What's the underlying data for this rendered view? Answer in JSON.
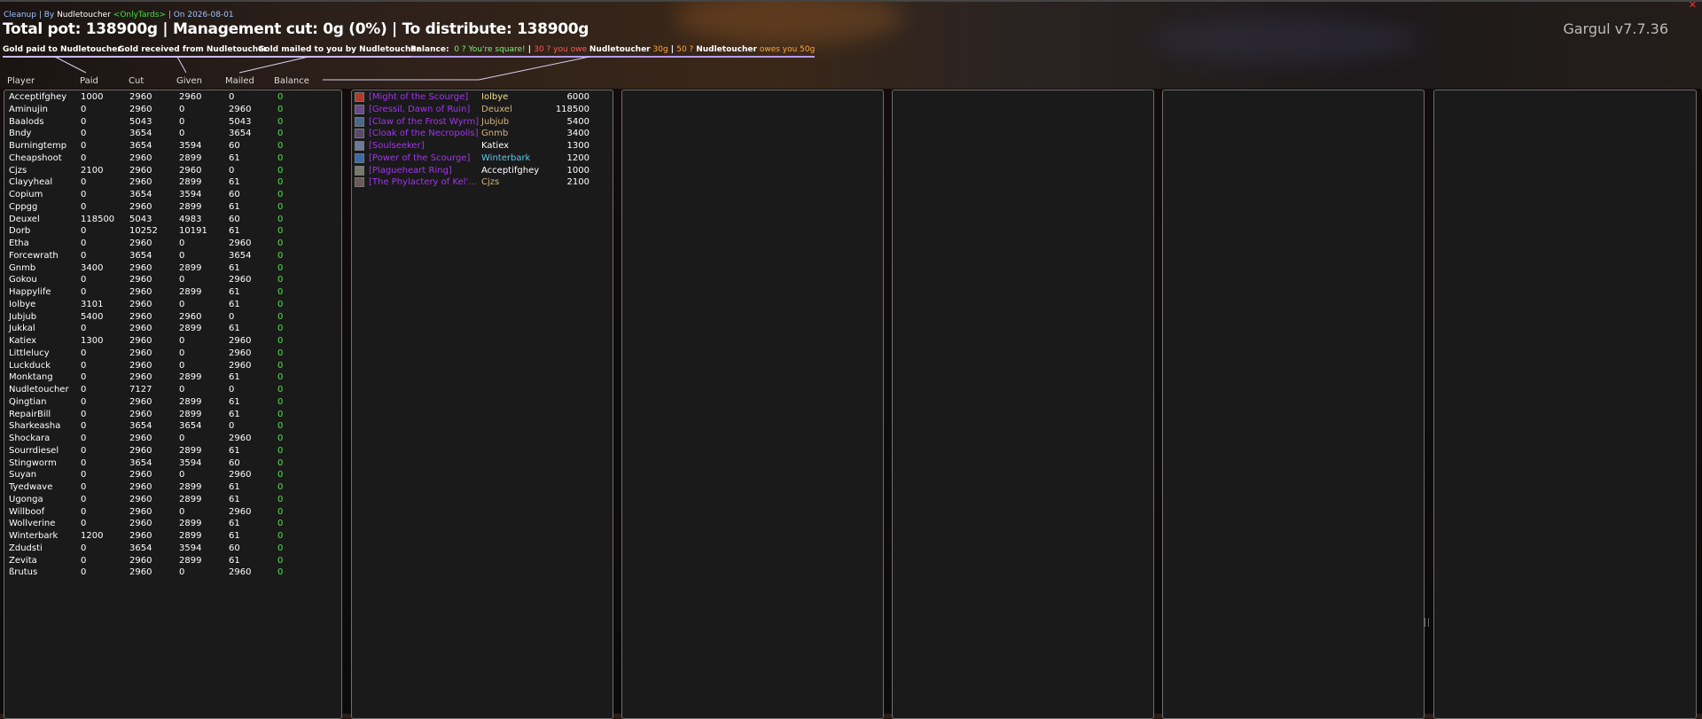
{
  "window": {
    "subline_prefix": "Cleanup | By ",
    "subline_author": "Nudletoucher",
    "subline_guild": "<OnlyTards>",
    "subline_date": " | On 2026-08-01",
    "headline": "Total pot: 138900g | Management cut: 0g (0%) | To distribute: 138900g",
    "version": "Gargul v7.7.36",
    "close_glyph": "✕"
  },
  "buttons": {
    "gold_paid": "Gold paid to Nudletoucher",
    "gold_received": "Gold received from Nudletoucher",
    "gold_mailed": "Gold mailed to you by Nudletoucher"
  },
  "balance": {
    "label": "Balance:",
    "square": "0 ? You're square!",
    "sep1": " | ",
    "you_owe": "30 ? you owe",
    "you_owe_name": "Nudletoucher",
    "you_owe_amt": "30g",
    "sep2": " | ",
    "owes_you_prefix": "50 ?",
    "owes_you_name": "Nudletoucher",
    "owes_you_text": "owes you 50g"
  },
  "columns": {
    "player": "Player",
    "paid": "Paid",
    "cut": "Cut",
    "given": "Given",
    "mailed": "Mailed",
    "balance": "Balance"
  },
  "players": [
    {
      "name": "Acceptifghey",
      "paid": "1000",
      "cut": "2960",
      "given": "2960",
      "mailed": "0",
      "balance": "0"
    },
    {
      "name": "Aminujin",
      "paid": "0",
      "cut": "2960",
      "given": "0",
      "mailed": "2960",
      "balance": "0"
    },
    {
      "name": "Baalods",
      "paid": "0",
      "cut": "5043",
      "given": "0",
      "mailed": "5043",
      "balance": "0"
    },
    {
      "name": "Bndy",
      "paid": "0",
      "cut": "3654",
      "given": "0",
      "mailed": "3654",
      "balance": "0"
    },
    {
      "name": "Burningtemp",
      "paid": "0",
      "cut": "3654",
      "given": "3594",
      "mailed": "60",
      "balance": "0"
    },
    {
      "name": "Cheapshoot",
      "paid": "0",
      "cut": "2960",
      "given": "2899",
      "mailed": "61",
      "balance": "0"
    },
    {
      "name": "Cjzs",
      "paid": "2100",
      "cut": "2960",
      "given": "2960",
      "mailed": "0",
      "balance": "0"
    },
    {
      "name": "Clayyheal",
      "paid": "0",
      "cut": "2960",
      "given": "2899",
      "mailed": "61",
      "balance": "0"
    },
    {
      "name": "Copium",
      "paid": "0",
      "cut": "3654",
      "given": "3594",
      "mailed": "60",
      "balance": "0"
    },
    {
      "name": "Cppgg",
      "paid": "0",
      "cut": "2960",
      "given": "2899",
      "mailed": "61",
      "balance": "0"
    },
    {
      "name": "Deuxel",
      "paid": "118500",
      "cut": "5043",
      "given": "4983",
      "mailed": "60",
      "balance": "0"
    },
    {
      "name": "Dorb",
      "paid": "0",
      "cut": "10252",
      "given": "10191",
      "mailed": "61",
      "balance": "0"
    },
    {
      "name": "Etha",
      "paid": "0",
      "cut": "2960",
      "given": "0",
      "mailed": "2960",
      "balance": "0"
    },
    {
      "name": "Forcewrath",
      "paid": "0",
      "cut": "3654",
      "given": "0",
      "mailed": "3654",
      "balance": "0"
    },
    {
      "name": "Gnmb",
      "paid": "3400",
      "cut": "2960",
      "given": "2899",
      "mailed": "61",
      "balance": "0"
    },
    {
      "name": "Gokou",
      "paid": "0",
      "cut": "2960",
      "given": "0",
      "mailed": "2960",
      "balance": "0"
    },
    {
      "name": "Happylife",
      "paid": "0",
      "cut": "2960",
      "given": "2899",
      "mailed": "61",
      "balance": "0"
    },
    {
      "name": "Iolbye",
      "paid": "3101",
      "cut": "2960",
      "given": "0",
      "mailed": "61",
      "balance": "0"
    },
    {
      "name": "Jubjub",
      "paid": "5400",
      "cut": "2960",
      "given": "2960",
      "mailed": "0",
      "balance": "0"
    },
    {
      "name": "Jukkal",
      "paid": "0",
      "cut": "2960",
      "given": "2899",
      "mailed": "61",
      "balance": "0"
    },
    {
      "name": "Katiex",
      "paid": "1300",
      "cut": "2960",
      "given": "0",
      "mailed": "2960",
      "balance": "0"
    },
    {
      "name": "Littlelucy",
      "paid": "0",
      "cut": "2960",
      "given": "0",
      "mailed": "2960",
      "balance": "0"
    },
    {
      "name": "Luckduck",
      "paid": "0",
      "cut": "2960",
      "given": "0",
      "mailed": "2960",
      "balance": "0"
    },
    {
      "name": "Monktang",
      "paid": "0",
      "cut": "2960",
      "given": "2899",
      "mailed": "61",
      "balance": "0"
    },
    {
      "name": "Nudletoucher",
      "paid": "0",
      "cut": "7127",
      "given": "0",
      "mailed": "0",
      "balance": "0"
    },
    {
      "name": "Qingtian",
      "paid": "0",
      "cut": "2960",
      "given": "2899",
      "mailed": "61",
      "balance": "0"
    },
    {
      "name": "RepairBill",
      "paid": "0",
      "cut": "2960",
      "given": "2899",
      "mailed": "61",
      "balance": "0"
    },
    {
      "name": "Sharkeasha",
      "paid": "0",
      "cut": "3654",
      "given": "3654",
      "mailed": "0",
      "balance": "0"
    },
    {
      "name": "Shockara",
      "paid": "0",
      "cut": "2960",
      "given": "0",
      "mailed": "2960",
      "balance": "0"
    },
    {
      "name": "Sourrdiesel",
      "paid": "0",
      "cut": "2960",
      "given": "2899",
      "mailed": "61",
      "balance": "0"
    },
    {
      "name": "Stingworm",
      "paid": "0",
      "cut": "3654",
      "given": "3594",
      "mailed": "60",
      "balance": "0"
    },
    {
      "name": "Suyan",
      "paid": "0",
      "cut": "2960",
      "given": "0",
      "mailed": "2960",
      "balance": "0"
    },
    {
      "name": "Tyedwave",
      "paid": "0",
      "cut": "2960",
      "given": "2899",
      "mailed": "61",
      "balance": "0"
    },
    {
      "name": "Ugonga",
      "paid": "0",
      "cut": "2960",
      "given": "2899",
      "mailed": "61",
      "balance": "0"
    },
    {
      "name": "Willboof",
      "paid": "0",
      "cut": "2960",
      "given": "0",
      "mailed": "2960",
      "balance": "0"
    },
    {
      "name": "Wollverine",
      "paid": "0",
      "cut": "2960",
      "given": "2899",
      "mailed": "61",
      "balance": "0"
    },
    {
      "name": "Winterbark",
      "paid": "1200",
      "cut": "2960",
      "given": "2899",
      "mailed": "61",
      "balance": "0"
    },
    {
      "name": "Zdudsti",
      "paid": "0",
      "cut": "3654",
      "given": "3594",
      "mailed": "60",
      "balance": "0"
    },
    {
      "name": "Zevita",
      "paid": "0",
      "cut": "2960",
      "given": "2899",
      "mailed": "61",
      "balance": "0"
    },
    {
      "name": "ßrutus",
      "paid": "0",
      "cut": "2960",
      "given": "0",
      "mailed": "2960",
      "balance": "0"
    }
  ],
  "items": [
    {
      "name": "[Might of the Scourge]",
      "winner": "Iolbye",
      "winner_color": "#f4e08a",
      "amount": "6000",
      "icon": "might-of-the-scourge-icon",
      "icon_color": "#b33a2a"
    },
    {
      "name": "[Gressil, Dawn of Ruin]",
      "winner": "Deuxel",
      "winner_color": "#d6b57c",
      "amount": "118500",
      "icon": "gressil-icon",
      "icon_color": "#6a4a8a"
    },
    {
      "name": "[Claw of the Frost Wyrm]",
      "winner": "Jubjub",
      "winner_color": "#d6b57c",
      "amount": "5400",
      "icon": "claw-frost-wyrm-icon",
      "icon_color": "#4a6a8a"
    },
    {
      "name": "[Cloak of the Necropolis]",
      "winner": "Gnmb",
      "winner_color": "#d6b57c",
      "amount": "3400",
      "icon": "cloak-necropolis-icon",
      "icon_color": "#5a4a6a"
    },
    {
      "name": "[Soulseeker]",
      "winner": "Katiex",
      "winner_color": "#ffffff",
      "amount": "1300",
      "icon": "soulseeker-icon",
      "icon_color": "#6a7a9a"
    },
    {
      "name": "[Power of the Scourge]",
      "winner": "Winterbark",
      "winner_color": "#5fc8e8",
      "amount": "1200",
      "icon": "power-of-the-scourge-icon",
      "icon_color": "#3a6aaa"
    },
    {
      "name": "[Plagueheart Ring]",
      "winner": "Acceptifghey",
      "winner_color": "#ffffff",
      "amount": "1000",
      "icon": "plagueheart-ring-icon",
      "icon_color": "#7a7a6a"
    },
    {
      "name": "[The Phylactery of Kel'...",
      "winner": "Cjzs",
      "winner_color": "#d6b57c",
      "amount": "2100",
      "icon": "phylactery-icon",
      "icon_color": "#6a5a5a"
    }
  ]
}
